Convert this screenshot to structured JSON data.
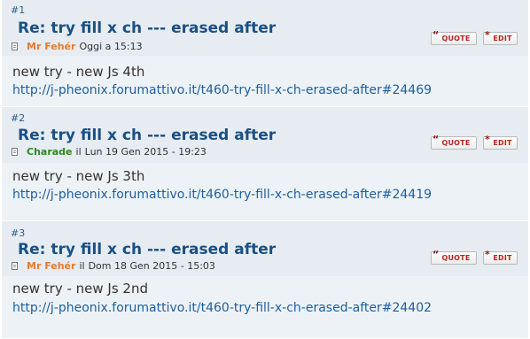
{
  "posts": [
    {
      "number": "#1",
      "title": "Re: try fill x ch --- erased after",
      "author": "Mr Fehér",
      "author_color": "#e47c2f",
      "date_prefix": "",
      "date": "Oggi a 15:13",
      "quote_label": "QUOTE",
      "edit_label": "EDIT",
      "text": "new try - new Js 4th",
      "link": "http://j-pheonix.forumattivo.it/t460-try-fill-x-ch-erased-after#24469"
    },
    {
      "number": "#2",
      "title": "Re: try fill x ch --- erased after",
      "author": "Charade",
      "author_color": "#2a8a1e",
      "date_prefix": "il",
      "date": "Lun 19 Gen 2015 - 19:23",
      "quote_label": "QUOTE",
      "edit_label": "EDIT",
      "text": "new try - new Js 3th",
      "link": "http://j-pheonix.forumattivo.it/t460-try-fill-x-ch-erased-after#24419"
    },
    {
      "number": "#3",
      "title": "Re: try fill x ch --- erased after",
      "author": "Mr Fehér",
      "author_color": "#e47c2f",
      "date_prefix": "il",
      "date": "Dom 18 Gen 2015 - 15:03",
      "quote_label": "QUOTE",
      "edit_label": "EDIT",
      "text": "new try - new Js 2nd",
      "link": "http://j-pheonix.forumattivo.it/t460-try-fill-x-ch-erased-after#24402"
    }
  ],
  "icons": {
    "quote": "quote-mark-icon",
    "edit": "pencil-icon",
    "post": "document-icon"
  }
}
